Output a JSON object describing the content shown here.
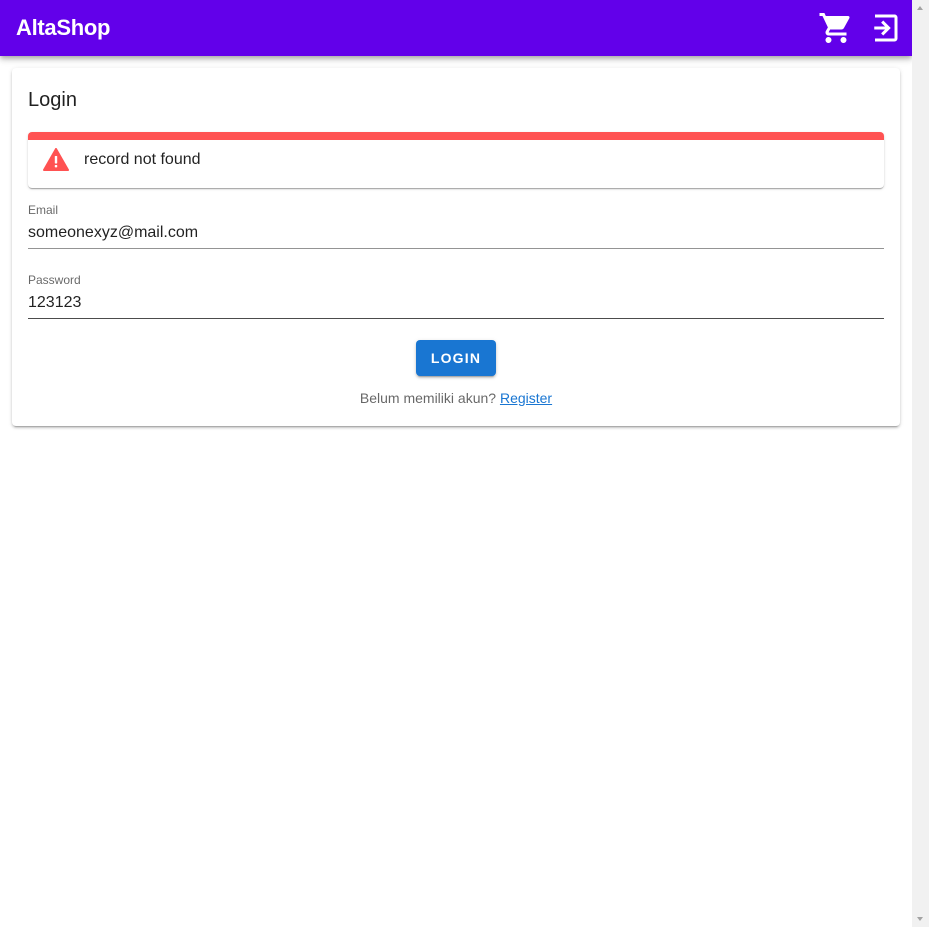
{
  "app": {
    "title": "AltaShop",
    "brand_color": "#6200ea",
    "icons": [
      "cart-icon",
      "login-icon"
    ]
  },
  "login_card": {
    "title": "Login",
    "alert": {
      "type": "error",
      "color": "#ff5252",
      "icon": "warning-icon",
      "message": "record not found"
    },
    "email": {
      "label": "Email",
      "value": "someonexyz@mail.com"
    },
    "password": {
      "label": "Password",
      "value": "123123"
    },
    "login_button": {
      "label": "LOGIN",
      "color": "#1976d2"
    },
    "register": {
      "prompt": "Belum memiliki akun?",
      "link_label": "Register"
    }
  }
}
